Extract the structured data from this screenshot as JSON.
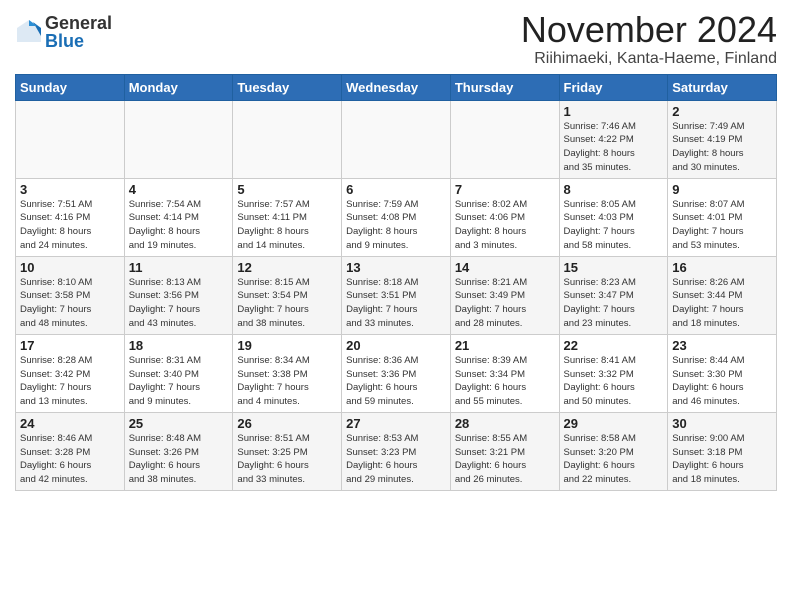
{
  "logo": {
    "general": "General",
    "blue": "Blue"
  },
  "title": "November 2024",
  "location": "Riihimaeki, Kanta-Haeme, Finland",
  "headers": [
    "Sunday",
    "Monday",
    "Tuesday",
    "Wednesday",
    "Thursday",
    "Friday",
    "Saturday"
  ],
  "weeks": [
    [
      {
        "day": "",
        "info": ""
      },
      {
        "day": "",
        "info": ""
      },
      {
        "day": "",
        "info": ""
      },
      {
        "day": "",
        "info": ""
      },
      {
        "day": "",
        "info": ""
      },
      {
        "day": "1",
        "info": "Sunrise: 7:46 AM\nSunset: 4:22 PM\nDaylight: 8 hours\nand 35 minutes."
      },
      {
        "day": "2",
        "info": "Sunrise: 7:49 AM\nSunset: 4:19 PM\nDaylight: 8 hours\nand 30 minutes."
      }
    ],
    [
      {
        "day": "3",
        "info": "Sunrise: 7:51 AM\nSunset: 4:16 PM\nDaylight: 8 hours\nand 24 minutes."
      },
      {
        "day": "4",
        "info": "Sunrise: 7:54 AM\nSunset: 4:14 PM\nDaylight: 8 hours\nand 19 minutes."
      },
      {
        "day": "5",
        "info": "Sunrise: 7:57 AM\nSunset: 4:11 PM\nDaylight: 8 hours\nand 14 minutes."
      },
      {
        "day": "6",
        "info": "Sunrise: 7:59 AM\nSunset: 4:08 PM\nDaylight: 8 hours\nand 9 minutes."
      },
      {
        "day": "7",
        "info": "Sunrise: 8:02 AM\nSunset: 4:06 PM\nDaylight: 8 hours\nand 3 minutes."
      },
      {
        "day": "8",
        "info": "Sunrise: 8:05 AM\nSunset: 4:03 PM\nDaylight: 7 hours\nand 58 minutes."
      },
      {
        "day": "9",
        "info": "Sunrise: 8:07 AM\nSunset: 4:01 PM\nDaylight: 7 hours\nand 53 minutes."
      }
    ],
    [
      {
        "day": "10",
        "info": "Sunrise: 8:10 AM\nSunset: 3:58 PM\nDaylight: 7 hours\nand 48 minutes."
      },
      {
        "day": "11",
        "info": "Sunrise: 8:13 AM\nSunset: 3:56 PM\nDaylight: 7 hours\nand 43 minutes."
      },
      {
        "day": "12",
        "info": "Sunrise: 8:15 AM\nSunset: 3:54 PM\nDaylight: 7 hours\nand 38 minutes."
      },
      {
        "day": "13",
        "info": "Sunrise: 8:18 AM\nSunset: 3:51 PM\nDaylight: 7 hours\nand 33 minutes."
      },
      {
        "day": "14",
        "info": "Sunrise: 8:21 AM\nSunset: 3:49 PM\nDaylight: 7 hours\nand 28 minutes."
      },
      {
        "day": "15",
        "info": "Sunrise: 8:23 AM\nSunset: 3:47 PM\nDaylight: 7 hours\nand 23 minutes."
      },
      {
        "day": "16",
        "info": "Sunrise: 8:26 AM\nSunset: 3:44 PM\nDaylight: 7 hours\nand 18 minutes."
      }
    ],
    [
      {
        "day": "17",
        "info": "Sunrise: 8:28 AM\nSunset: 3:42 PM\nDaylight: 7 hours\nand 13 minutes."
      },
      {
        "day": "18",
        "info": "Sunrise: 8:31 AM\nSunset: 3:40 PM\nDaylight: 7 hours\nand 9 minutes."
      },
      {
        "day": "19",
        "info": "Sunrise: 8:34 AM\nSunset: 3:38 PM\nDaylight: 7 hours\nand 4 minutes."
      },
      {
        "day": "20",
        "info": "Sunrise: 8:36 AM\nSunset: 3:36 PM\nDaylight: 6 hours\nand 59 minutes."
      },
      {
        "day": "21",
        "info": "Sunrise: 8:39 AM\nSunset: 3:34 PM\nDaylight: 6 hours\nand 55 minutes."
      },
      {
        "day": "22",
        "info": "Sunrise: 8:41 AM\nSunset: 3:32 PM\nDaylight: 6 hours\nand 50 minutes."
      },
      {
        "day": "23",
        "info": "Sunrise: 8:44 AM\nSunset: 3:30 PM\nDaylight: 6 hours\nand 46 minutes."
      }
    ],
    [
      {
        "day": "24",
        "info": "Sunrise: 8:46 AM\nSunset: 3:28 PM\nDaylight: 6 hours\nand 42 minutes."
      },
      {
        "day": "25",
        "info": "Sunrise: 8:48 AM\nSunset: 3:26 PM\nDaylight: 6 hours\nand 38 minutes."
      },
      {
        "day": "26",
        "info": "Sunrise: 8:51 AM\nSunset: 3:25 PM\nDaylight: 6 hours\nand 33 minutes."
      },
      {
        "day": "27",
        "info": "Sunrise: 8:53 AM\nSunset: 3:23 PM\nDaylight: 6 hours\nand 29 minutes."
      },
      {
        "day": "28",
        "info": "Sunrise: 8:55 AM\nSunset: 3:21 PM\nDaylight: 6 hours\nand 26 minutes."
      },
      {
        "day": "29",
        "info": "Sunrise: 8:58 AM\nSunset: 3:20 PM\nDaylight: 6 hours\nand 22 minutes."
      },
      {
        "day": "30",
        "info": "Sunrise: 9:00 AM\nSunset: 3:18 PM\nDaylight: 6 hours\nand 18 minutes."
      }
    ]
  ]
}
